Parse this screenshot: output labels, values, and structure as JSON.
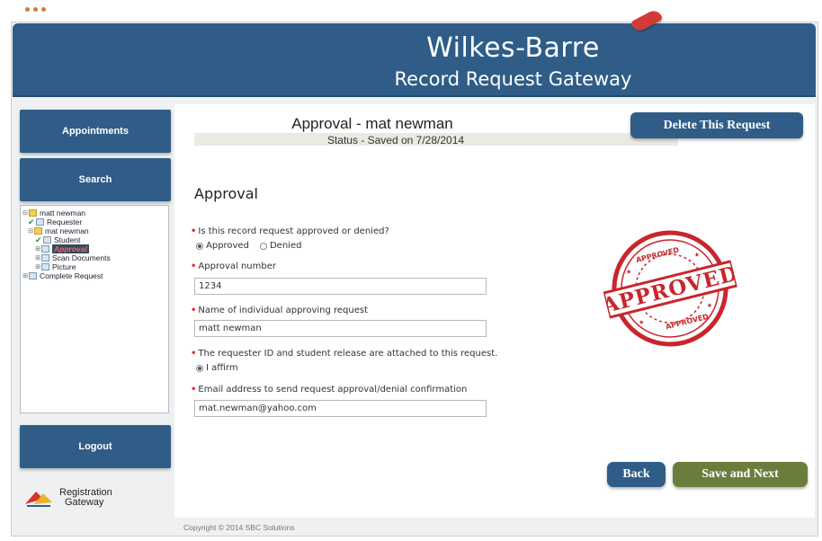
{
  "header": {
    "title": "Wilkes-Barre",
    "subtitle": "Record Request Gateway"
  },
  "sidebar": {
    "appointments_label": "Appointments",
    "search_label": "Search",
    "logout_label": "Logout",
    "tree": [
      {
        "label": "matt newman"
      },
      {
        "label": "Requester"
      },
      {
        "label": "mat newman"
      },
      {
        "label": "Student"
      },
      {
        "label": "Approval"
      },
      {
        "label": "Scan Documents"
      },
      {
        "label": "Picture"
      },
      {
        "label": "Complete Request"
      }
    ]
  },
  "main": {
    "page_title": "Approval - mat newman",
    "status": "Status - Saved on 7/28/2014",
    "delete_label": "Delete This Request",
    "section_title": "Approval",
    "q1": {
      "label": "Is this record request approved or denied?",
      "option_approved": "Approved",
      "option_denied": "Denied",
      "selected": "Approved"
    },
    "q2": {
      "label": "Approval number",
      "value": "1234"
    },
    "q3": {
      "label": "Name of individual approving request",
      "value": "matt newman"
    },
    "q4": {
      "label": "The requester ID and student release are attached to this request.",
      "option": "I affirm"
    },
    "q5": {
      "label": "Email address to send request approval/denial confirmation",
      "value": "mat.newman@yahoo.com"
    },
    "stamp_text": "APPROVED",
    "back_label": "Back",
    "next_label": "Save and Next"
  },
  "logo": {
    "line1": "Registration",
    "line2": "Gateway"
  },
  "footer": {
    "copyright": "Copyright © 2014 SBC Solutions"
  },
  "colors": {
    "brand_blue": "#2f5d87",
    "save_green": "#6a7d3c",
    "stamp_red": "#c8262c",
    "required_red": "#e0312f"
  }
}
